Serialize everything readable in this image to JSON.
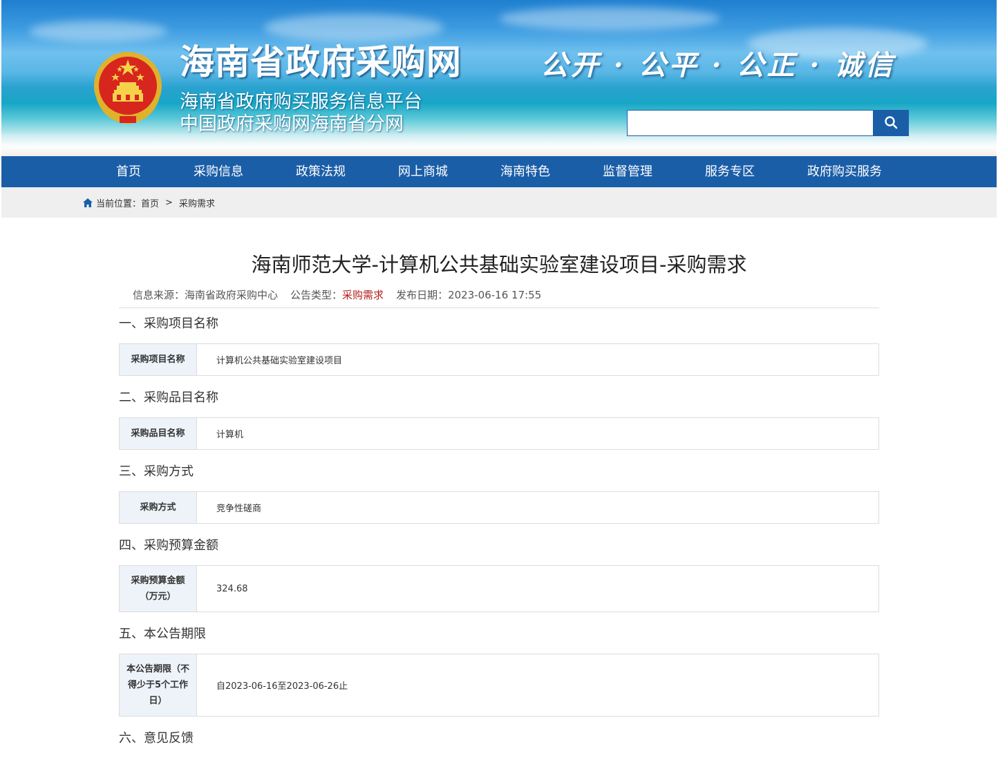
{
  "header": {
    "site_title": "海南省政府采购网",
    "subtitle_1": "海南省政府购买服务信息平台",
    "subtitle_2": "中国政府采购网海南省分网",
    "slogan": "公开 · 公平 · 公正 · 诚信",
    "search": {
      "value": "",
      "placeholder": ""
    },
    "emblem_icon": "national-emblem-icon",
    "search_icon": "search-icon"
  },
  "nav": {
    "items": [
      "首页",
      "采购信息",
      "政策法规",
      "网上商城",
      "海南特色",
      "监督管理",
      "服务专区",
      "政府购买服务"
    ]
  },
  "breadcrumb": {
    "label": "当前位置：",
    "home": "首页",
    "separator": ">",
    "current": "采购需求"
  },
  "article": {
    "title": "海南师范大学-计算机公共基础实验室建设项目-采购需求",
    "source_label": "信息来源：",
    "source_value": "海南省政府采购中心",
    "type_label": "公告类型：",
    "type_value": "采购需求",
    "date_label": "发布日期：",
    "date_value": "2023-06-16 17:55",
    "sections": [
      {
        "heading": "一、采购项目名称",
        "label": "采购项目名称",
        "value": "计算机公共基础实验室建设项目"
      },
      {
        "heading": "二、采购品目名称",
        "label": "采购品目名称",
        "value": "计算机"
      },
      {
        "heading": "三、采购方式",
        "label": "采购方式",
        "value": "竞争性磋商"
      },
      {
        "heading": "四、采购预算金额",
        "label": "采购预算金额（万元）",
        "value": "324.68"
      },
      {
        "heading": "五、本公告期限",
        "label": "本公告期限（不得少于5个工作日）",
        "value": "自2023-06-16至2023-06-26止"
      },
      {
        "heading": "六、意见反馈"
      }
    ]
  },
  "colors": {
    "nav_blue": "#1b5ea8",
    "label_bg": "#eef3fa",
    "notice_type_red": "#b71c1c",
    "breadcrumb_bg": "#efefef"
  }
}
